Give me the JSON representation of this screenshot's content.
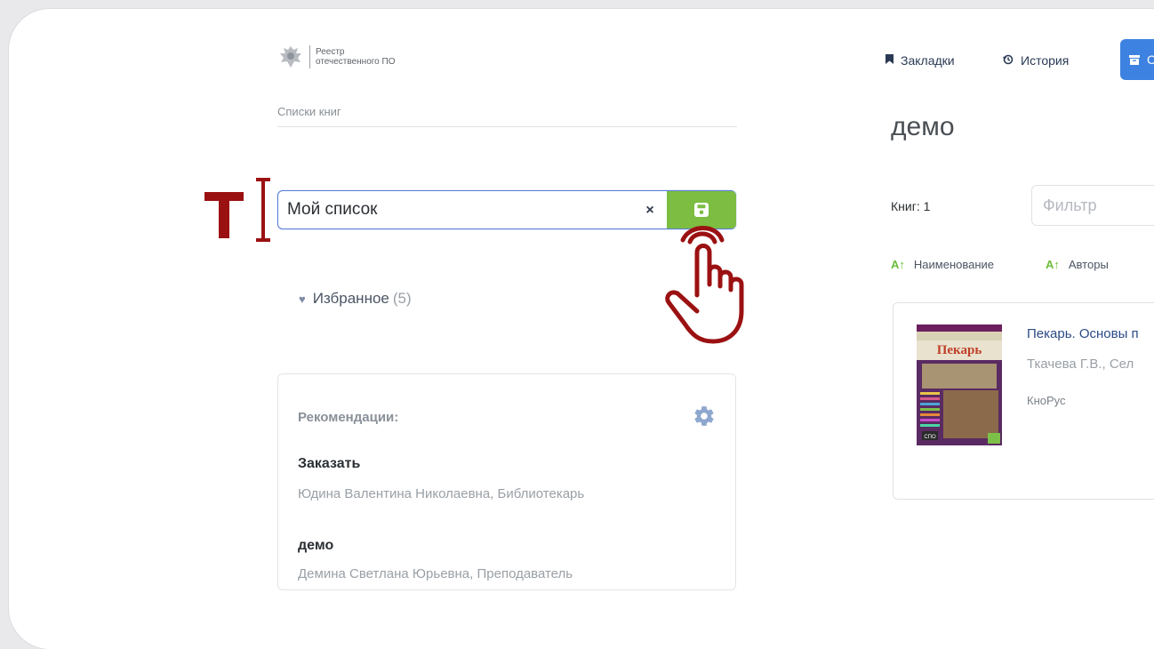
{
  "logo": {
    "line1": "Реестр",
    "line2": "отечественного ПО"
  },
  "sidebar": {
    "section_title": "Списки книг",
    "new_list": {
      "value": "Мой список",
      "clear_label": "×"
    },
    "favorites": {
      "label": "Избранное",
      "count": "(5)"
    },
    "recommendations": {
      "title": "Рекомендации:",
      "items": [
        {
          "title": "Заказать",
          "subtitle": "Юдина Валентина Николаевна, Библиотекарь"
        },
        {
          "title": "демо",
          "subtitle": "Демина Светлана Юрьевна, Преподаватель"
        }
      ]
    }
  },
  "header": {
    "bookmarks_label": "Закладки",
    "history_label": "История",
    "button_partial_label": "С"
  },
  "main": {
    "title": "демо",
    "books_count": "Книг: 1",
    "filter_placeholder": "Фильтр",
    "sort_name_label": "Наименование",
    "sort_authors_label": "Авторы",
    "sort_icon_text": "А↑",
    "book": {
      "title": "Пекарь. Основы п",
      "authors": "Ткачева Г.В., Сел",
      "publisher": "КноРус",
      "cover_title": "Пекарь",
      "cover_badge": "СПО"
    }
  },
  "colors": {
    "accent_blue": "#3d82e0",
    "save_green": "#7cbd42",
    "annotation_red": "#9b1112",
    "sort_green": "#6cbd3a"
  }
}
